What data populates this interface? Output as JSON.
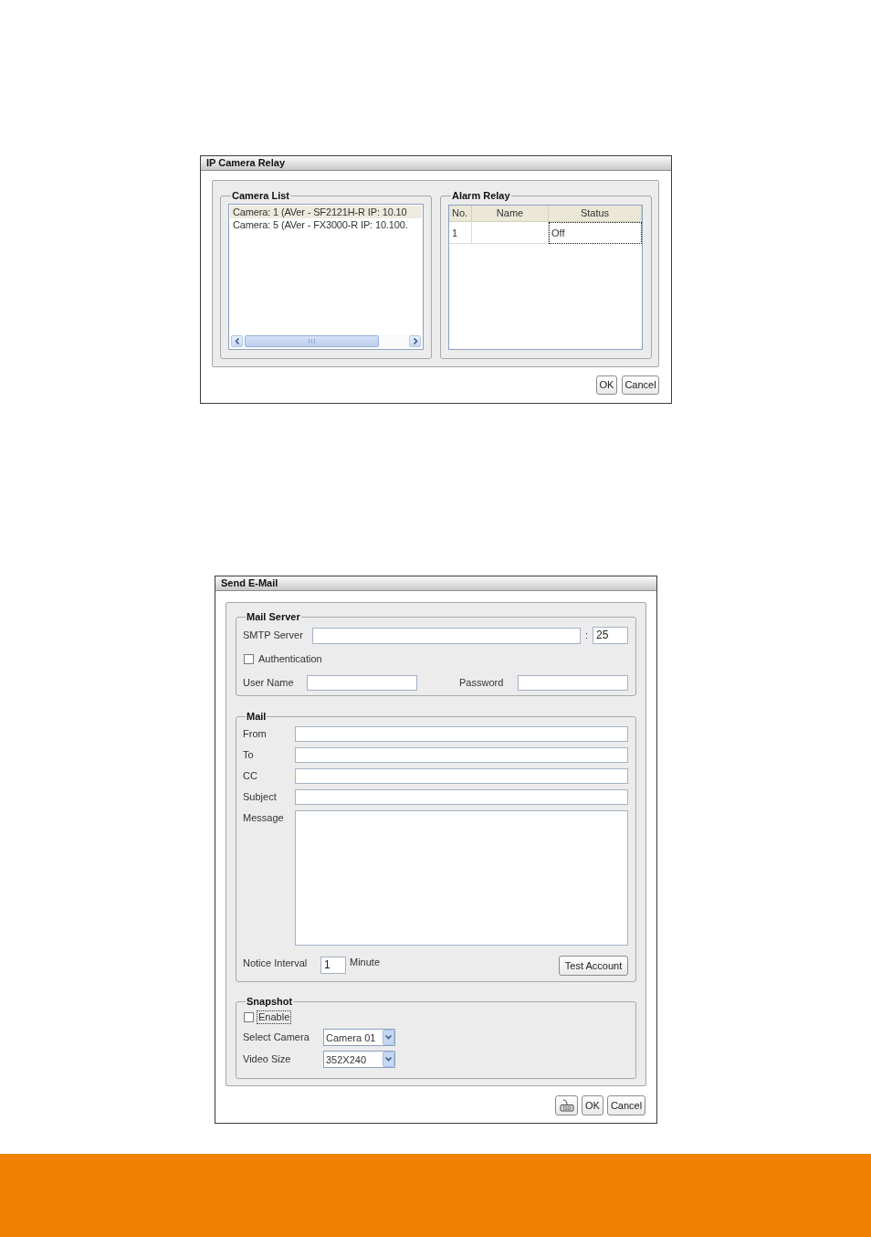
{
  "ip_camera_relay": {
    "title": "IP Camera Relay",
    "camera_list": {
      "label": "Camera List",
      "items": [
        {
          "text": "Camera: 1 (AVer - SF2121H-R IP: 10.10",
          "selected": true
        },
        {
          "text": "Camera: 5 (AVer - FX3000-R IP: 10.100.",
          "selected": false
        }
      ]
    },
    "alarm_relay": {
      "label": "Alarm Relay",
      "columns": [
        "No.",
        "Name",
        "Status"
      ],
      "rows": [
        {
          "cells": [
            {
              "text": "1",
              "focused": false
            },
            {
              "focused": false
            },
            {
              "text": "Off",
              "focused": true
            }
          ]
        }
      ]
    },
    "buttons": [
      "OK",
      "Cancel"
    ]
  },
  "send_email": {
    "title": "Send E-Mail",
    "mail_server": {
      "label": "Mail Server",
      "smtp_server": {
        "label": "SMTP Server"
      },
      "port": {
        "separator": ":",
        "value": "25"
      },
      "authentication": {
        "label": "Authentication",
        "checked": false
      },
      "user_name": {
        "label": "User Name"
      },
      "password": {
        "label": "Password"
      }
    },
    "mail": {
      "label": "Mail",
      "fields": [
        {
          "label": "From"
        },
        {
          "label": "To"
        },
        {
          "label": "CC"
        },
        {
          "label": "Subject"
        }
      ],
      "message": {
        "label": "Message"
      },
      "notice_interval": {
        "label": "Notice Interval",
        "value": "1",
        "unit": "Minute"
      },
      "test_button": "Test Account"
    },
    "snapshot": {
      "label": "Snapshot",
      "enable": {
        "label": "Enable",
        "checked": false,
        "focused": true
      },
      "dropdowns": [
        {
          "label": "Select Camera",
          "value": "Camera 01"
        },
        {
          "label": "Video Size",
          "value": "352X240"
        }
      ]
    },
    "buttons": [
      {
        "kind": "icon"
      },
      {
        "kind": "text",
        "label": "OK"
      },
      {
        "kind": "text",
        "label": "Cancel"
      }
    ]
  }
}
